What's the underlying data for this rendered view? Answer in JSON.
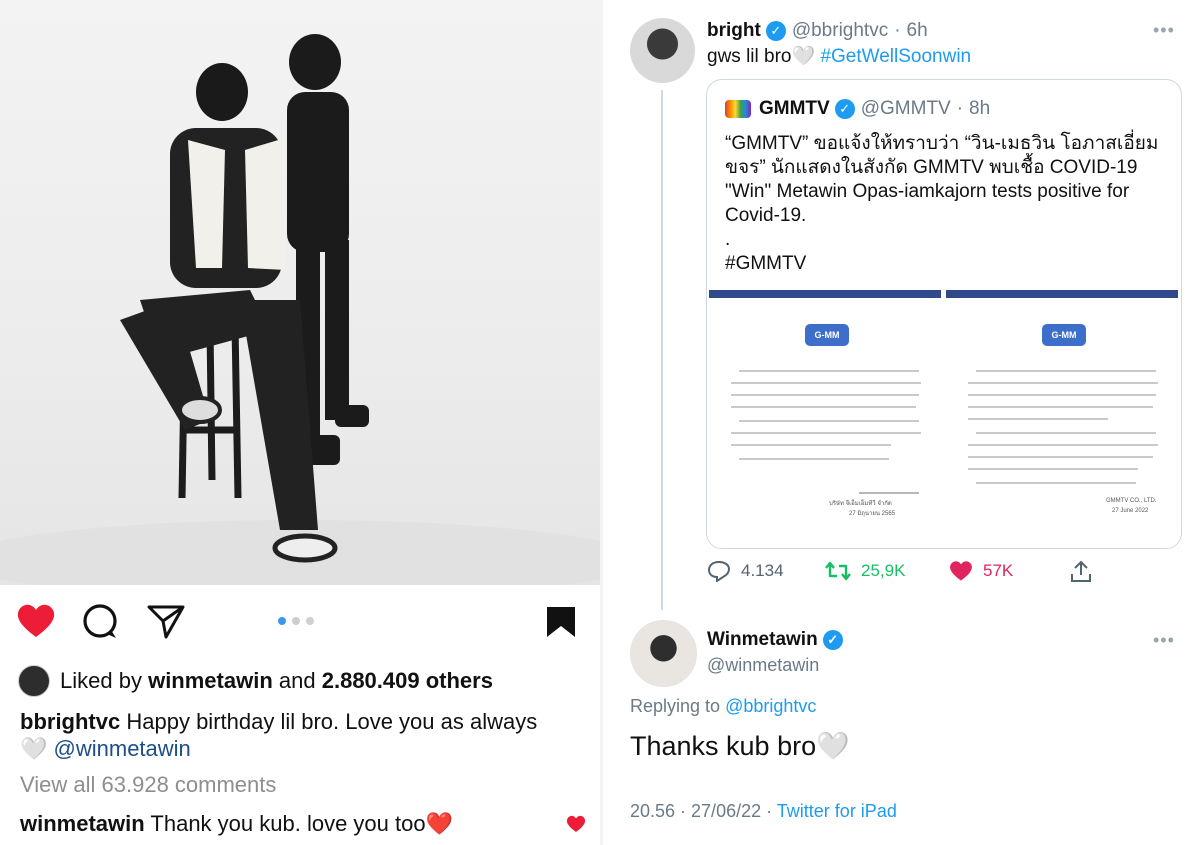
{
  "instagram": {
    "carousel": {
      "total": 3,
      "active": 1
    },
    "likes": {
      "prefix": "Liked by",
      "user": "winmetawin",
      "joiner": "and",
      "count": "2.880.409 others"
    },
    "caption": {
      "user": "bbrightvc",
      "text": "Happy birthday lil bro. Love you as always",
      "emoji": "🤍",
      "mention": "@winmetawin"
    },
    "view_all": "View all 63.928 comments",
    "comment": {
      "user": "winmetawin",
      "text": "Thank you kub. love you too",
      "emoji": "❤️"
    }
  },
  "twitter": {
    "tweet": {
      "name": "bright",
      "handle": "@bbrightvc",
      "sep": "·",
      "time": "6h",
      "text": "gws lil bro",
      "emoji": "🤍",
      "hashtag": "#GetWellSoonwin",
      "more": "•••"
    },
    "quote": {
      "name": "GMMTV",
      "handle": "@GMMTV",
      "sep": "·",
      "time": "8h",
      "line1": "“GMMTV” ขอแจ้งให้ทราบว่า “วิน-เมธวิน โอภาสเอี่ยม",
      "line2": "ขจร” นักแสดงในสังกัด GMMTV พบเชื้อ COVID-19",
      "line3": "\"Win\" Metawin Opas-iamkajorn tests positive for",
      "line4": "Covid-19.",
      "line5": ".",
      "hashtag": "#GMMTV",
      "doc_logo": "G-MM",
      "doc_left_sign": "บริษัท จีเอ็มเอ็มทีวี จำกัด",
      "doc_left_date": "27 มิถุนายน 2565",
      "doc_right_sign": "GMMTV CO., LTD.",
      "doc_right_date": "27 June 2022"
    },
    "stats": {
      "replies": "4.134",
      "retweets": "25,9K",
      "likes": "57K"
    },
    "reply": {
      "name": "Winmetawin",
      "handle": "@winmetawin",
      "replying_prefix": "Replying to",
      "replying_to": "@bbrightvc",
      "text": "Thanks kub bro",
      "emoji": "🤍",
      "date": "20.56 · 27/06/22 ·",
      "source": "Twitter for iPad",
      "more": "•••"
    }
  },
  "colors": {
    "ig_like": "#ed1d38",
    "tw_blue": "#1d9bf0",
    "tw_retweet": "#17bf63",
    "tw_like": "#e0245e",
    "doc_bar": "#2e4a8a"
  }
}
